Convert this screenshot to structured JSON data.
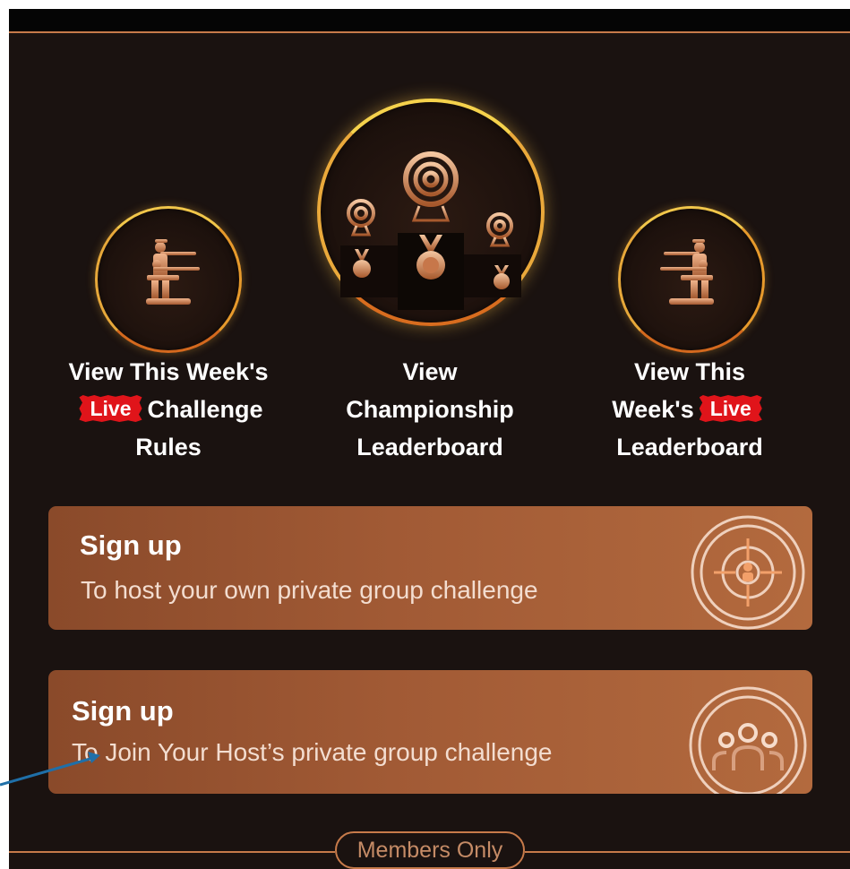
{
  "tiles": [
    {
      "id": "rules",
      "lines": [
        "View This Week's",
        "",
        "Rules"
      ],
      "live_badge": "Live",
      "live_suffix": "Challenge"
    },
    {
      "id": "championship",
      "lines": [
        "View",
        "Championship",
        "Leaderboard"
      ]
    },
    {
      "id": "weekly-leaderboard",
      "lines": [
        "View This",
        "Week's",
        "Leaderboard"
      ],
      "live_badge": "Live"
    }
  ],
  "cards": [
    {
      "title": "Sign up",
      "subtitle": "To host your own private group challenge",
      "icon": "crosshair-target-icon"
    },
    {
      "title": "Sign up",
      "subtitle": "To Join Your Host’s private group challenge",
      "icon": "group-people-icon"
    }
  ],
  "footer": {
    "badge": "Members Only"
  },
  "colors": {
    "accent": "#c67a4a",
    "live": "#e0141a",
    "background": "#1a1210",
    "card": "#a15a35"
  }
}
